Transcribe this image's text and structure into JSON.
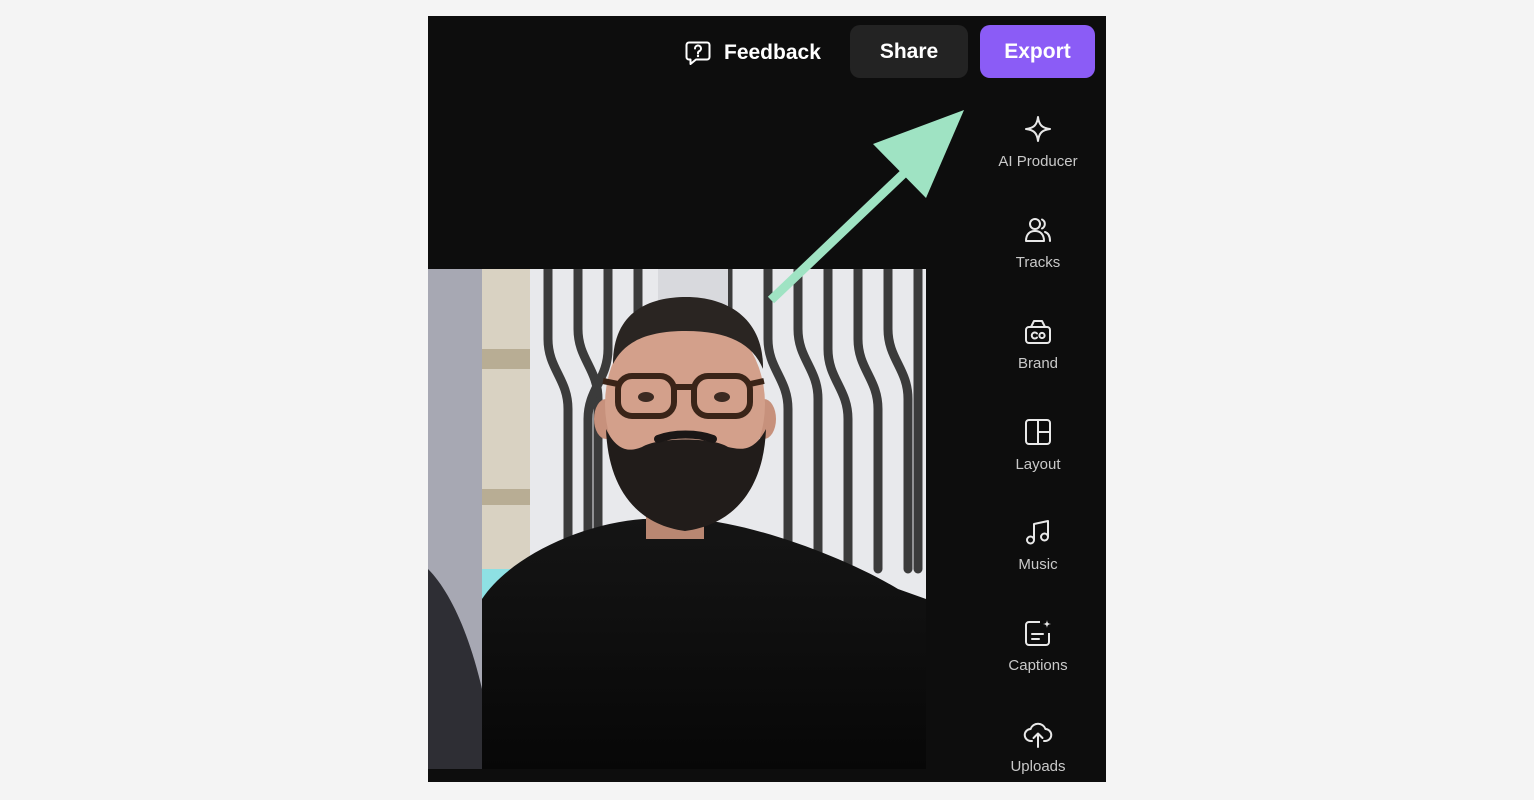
{
  "colors": {
    "app_background": "#0d0d0d",
    "accent": "#8b5cf6",
    "share_background": "#232323",
    "annotation_arrow": "#9fe3c3"
  },
  "header": {
    "feedback": {
      "label": "Feedback",
      "icon": "help-bubble-icon"
    },
    "share_label": "Share",
    "export_label": "Export"
  },
  "sidebar": {
    "items": [
      {
        "label": "AI Producer",
        "icon": "sparkle-icon"
      },
      {
        "label": "Tracks",
        "icon": "people-icon"
      },
      {
        "label": "Brand",
        "icon": "brand-kit-icon"
      },
      {
        "label": "Layout",
        "icon": "layout-icon"
      },
      {
        "label": "Music",
        "icon": "music-note-icon"
      },
      {
        "label": "Captions",
        "icon": "captions-icon"
      },
      {
        "label": "Uploads",
        "icon": "cloud-upload-icon"
      }
    ]
  },
  "preview": {
    "subject": "video-frame-person"
  },
  "annotation": {
    "type": "arrow",
    "points_to": "export-button"
  }
}
